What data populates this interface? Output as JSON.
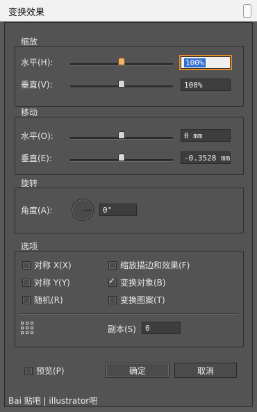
{
  "window": {
    "title": "变换效果"
  },
  "scale": {
    "group_title": "缩放",
    "horizontal": {
      "label": "水平(H):",
      "value": "100%",
      "slider_fraction": 0.5
    },
    "vertical": {
      "label": "垂直(V):",
      "value": "100%",
      "slider_fraction": 0.5
    }
  },
  "move": {
    "group_title": "移动",
    "horizontal": {
      "label": "水平(O):",
      "value": "0 mm",
      "slider_fraction": 0.5
    },
    "vertical": {
      "label": "垂直(E):",
      "value": "-0.3528 mm",
      "slider_fraction": 0.5
    }
  },
  "rotate": {
    "group_title": "旋转",
    "angle": {
      "label": "角度(A):",
      "value": "0°"
    }
  },
  "options": {
    "group_title": "选项",
    "checkboxes": [
      {
        "label": "对称 X(X)",
        "checked": false
      },
      {
        "label": "缩放描边和效果(F)",
        "checked": false
      },
      {
        "label": "对称 Y(Y)",
        "checked": false
      },
      {
        "label": "变换对象(B)",
        "checked": true
      },
      {
        "label": "随机(R)",
        "checked": false
      },
      {
        "label": "变换图案(T)",
        "checked": false
      }
    ],
    "copies": {
      "label": "副本(S)",
      "value": "0"
    }
  },
  "footer": {
    "preview": {
      "label": "预览(P)",
      "checked": false
    },
    "ok_label": "确定",
    "cancel_label": "取消"
  },
  "watermark": {
    "text": "Bai 贴吧 | illustrator吧"
  }
}
